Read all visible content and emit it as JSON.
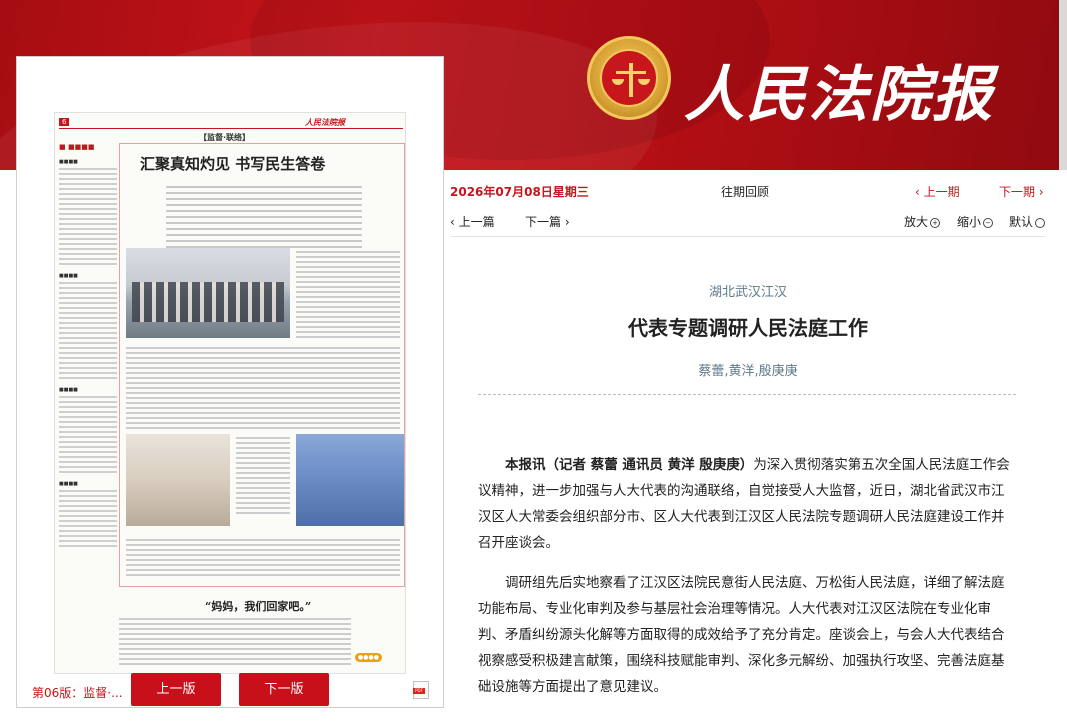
{
  "header": {
    "masthead": "人民法院报",
    "emblem": "court-emblem-icon"
  },
  "paper_preview": {
    "page_tag": "6",
    "section": "【监督·联络】",
    "feature_title": "汇聚真知灼见  书写民生答卷",
    "bottom_title": "“妈妈，我们回家吧。”",
    "small_masthead": "人民法院报"
  },
  "pager": {
    "label": "第06版：监督·...",
    "prev_page": "上一版",
    "next_page": "下一版",
    "pdf_icon": "pdf-icon"
  },
  "toolbar": {
    "date": "2026年07月08日星期三",
    "past_review": "往期回顾",
    "prev_issue": "‹ 上一期",
    "next_issue": "下一期 ›",
    "prev_article": "‹ 上一篇",
    "next_article": "下一篇 ›",
    "zoom_in": "放大",
    "zoom_out": "缩小",
    "default": "默认"
  },
  "article": {
    "kicker": "湖北武汉江汉",
    "title": "代表专题调研人民法庭工作",
    "authors": "蔡蕾,黄洋,殷庚庚",
    "para1_lead": "本报讯（记者 蔡蕾 通讯员 黄洋 殷庚庚）",
    "para1_rest": "为深入贯彻落实第五次全国人民法庭工作会议精神，进一步加强与人大代表的沟通联络，自觉接受人大监督，近日，湖北省武汉市江汉区人大常委会组织部分市、区人大代表到江汉区人民法院专题调研人民法庭建设工作并召开座谈会。",
    "para2": "调研组先后实地察看了江汉区法院民意街人民法庭、万松街人民法庭，详细了解法庭功能布局、专业化审判及参与基层社会治理等情况。人大代表对江汉区法院在专业化审判、矛盾纠纷源头化解等方面取得的成效给予了充分肯定。座谈会上，与会人大代表结合视察感受积极建言献策，围绕科技赋能审判、深化多元解纷、加强执行攻坚、完善法庭基础设施等方面提出了意见建议。"
  }
}
